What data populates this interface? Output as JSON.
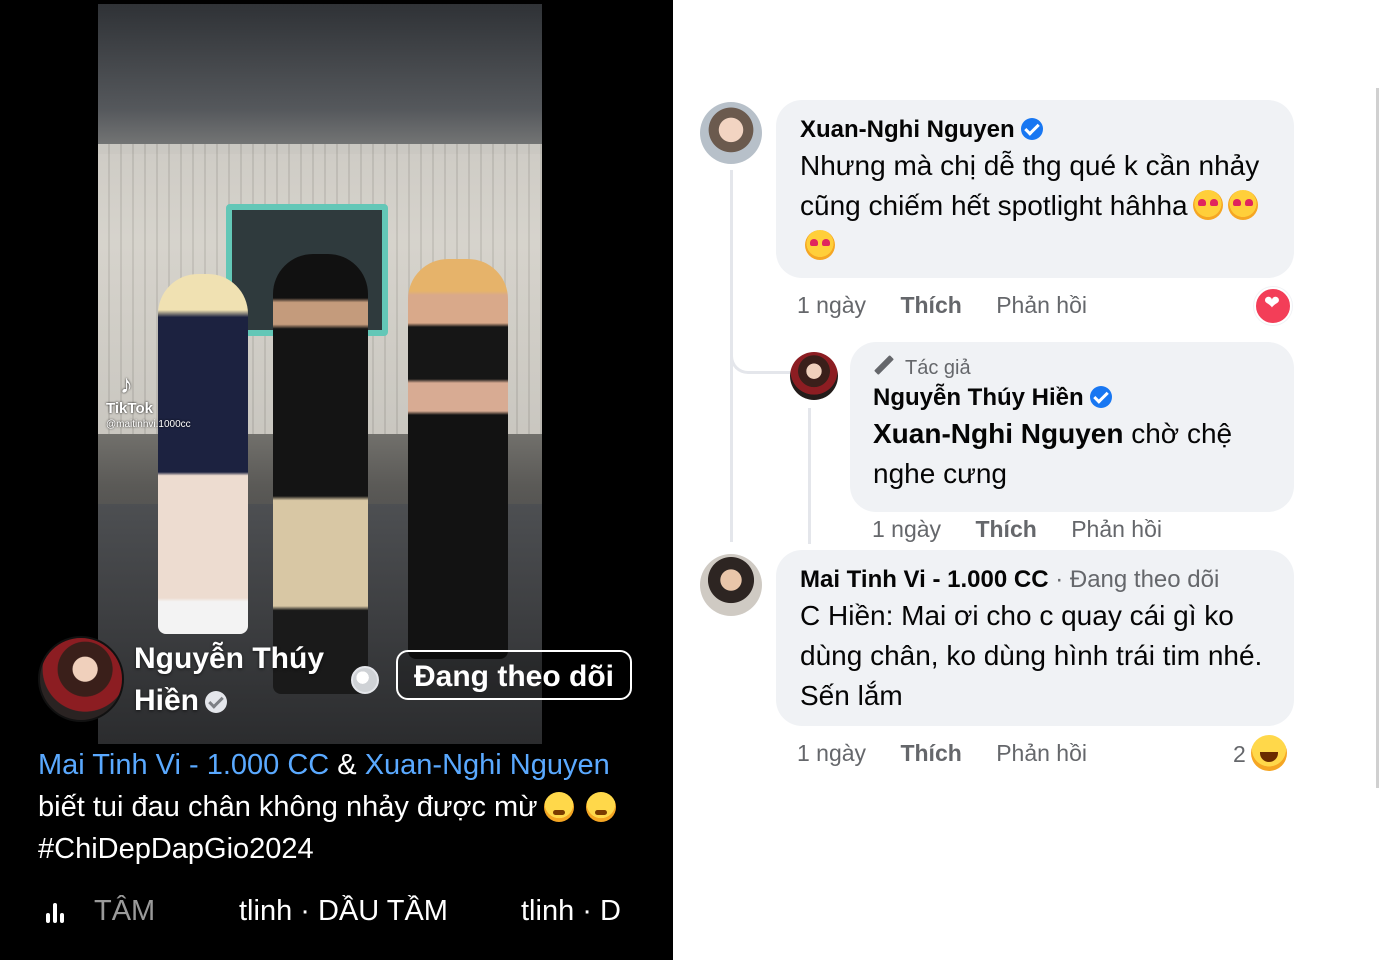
{
  "video": {
    "watermark": {
      "app": "TikTok",
      "handle": "@maitinhvi.1000cc"
    },
    "author": {
      "name": "Nguyễn Thúy Hiền",
      "follow_label": "Đang theo dõi"
    },
    "caption": {
      "mention_1": "Mai Tinh Vi - 1.000 CC",
      "and": "&",
      "mention_2": "Xuan-Nghi Nguyen",
      "text": "biết tui đau chân không nhảy được mừ",
      "hashtag": "#ChiDepDapGio2024"
    },
    "music": {
      "part_1": "TÂM",
      "part_2": "tlinh · DẦU TẦM",
      "part_3": "tlinh · D"
    }
  },
  "comments": [
    {
      "author": "Xuan-Nghi Nguyen",
      "text": "Nhưng mà chị dễ thg qué k cần nhảy cũng chiếm hết spotlight hâhha",
      "time": "1 ngày",
      "like_label": "Thích",
      "reply_label": "Phản hồi"
    },
    {
      "author_tag": "Tác giả",
      "author": "Nguyễn Thúy Hiền",
      "mention": "Xuan-Nghi Nguyen",
      "text": "chờ chệ nghe cưng",
      "time": "1 ngày",
      "like_label": "Thích",
      "reply_label": "Phản hồi"
    },
    {
      "author": "Mai Tinh Vi - 1.000 CC",
      "follow_status": "· Đang theo dõi",
      "text": "C Hiền: Mai ơi cho c quay cái gì ko dùng chân, ko dùng hình trái tim nhé. Sến lắm",
      "time": "1 ngày",
      "like_label": "Thích",
      "reply_label": "Phản hồi",
      "reaction_count": "2"
    }
  ],
  "colors": {
    "mention_blue": "#5aa9ff",
    "verified_blue": "#1877f2",
    "bubble_bg": "#f0f2f5",
    "heart_red": "#f33e58"
  }
}
